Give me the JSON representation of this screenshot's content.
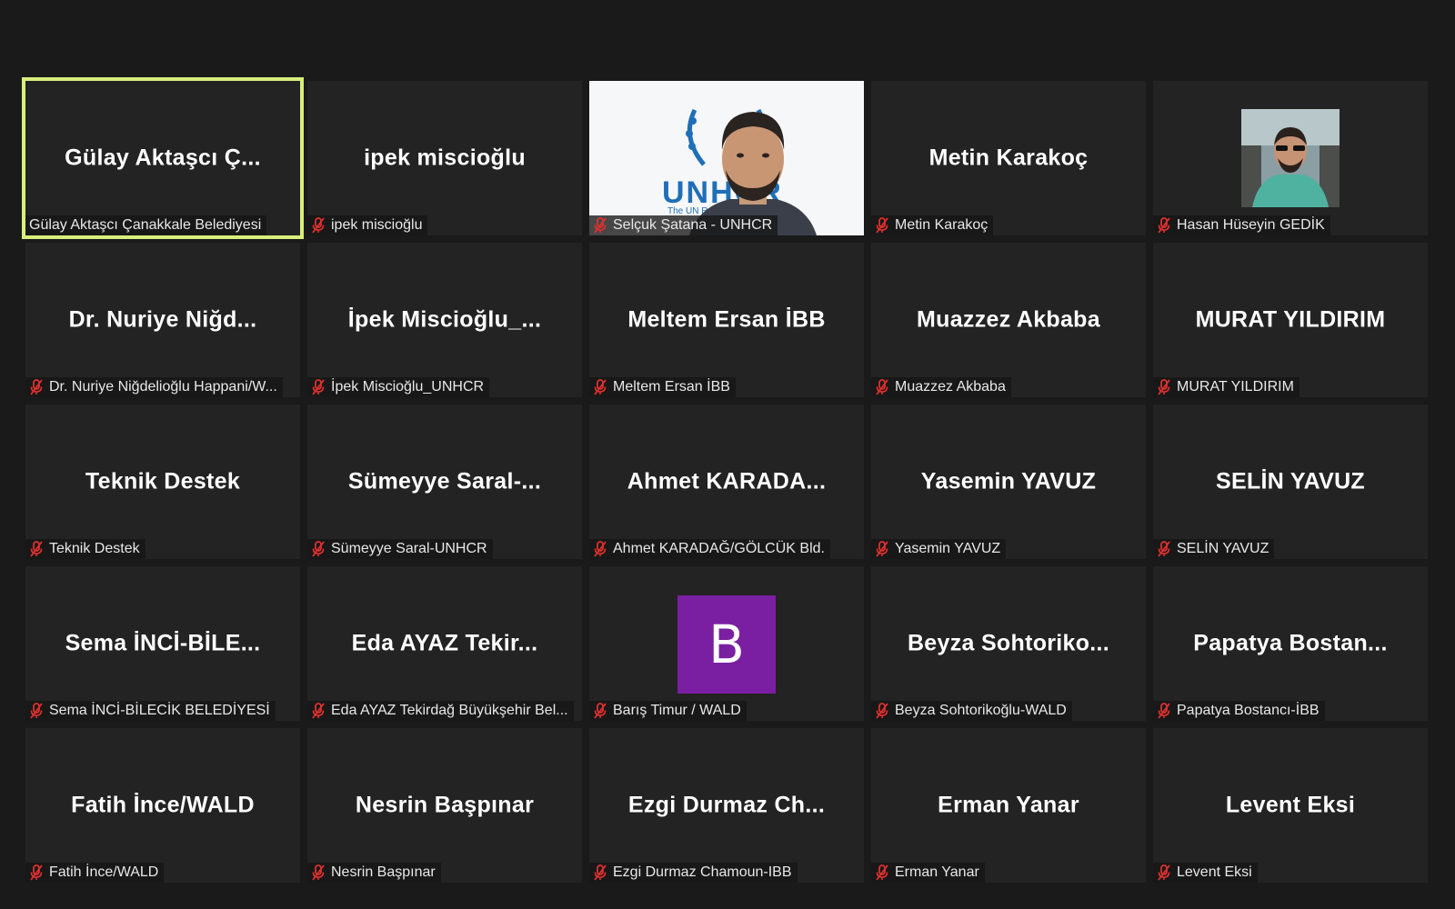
{
  "participants": [
    {
      "tile_name": "Gülay Aktaşcı Ç...",
      "label": "Gülay Aktaşcı Çanakkale Belediyesi",
      "muted": false,
      "active": true,
      "kind": "name"
    },
    {
      "tile_name": "ipek miscioğlu",
      "label": "ipek miscioğlu",
      "muted": true,
      "kind": "name"
    },
    {
      "tile_name": "",
      "label": "Selçuk Şatana - UNHCR",
      "muted": true,
      "kind": "video",
      "logo_text": "UNHCR",
      "logo_sub": "The UN Refugee Agency"
    },
    {
      "tile_name": "Metin Karakoç",
      "label": "Metin Karakoç",
      "muted": true,
      "kind": "name"
    },
    {
      "tile_name": "",
      "label": "Hasan Hüseyin GEDİK",
      "muted": true,
      "kind": "photo"
    },
    {
      "tile_name": "Dr. Nuriye Niğd...",
      "label": "Dr. Nuriye Niğdelioğlu Happani/W...",
      "muted": true,
      "kind": "name"
    },
    {
      "tile_name": "İpek Miscioğlu_...",
      "label": "İpek Miscioğlu_UNHCR",
      "muted": true,
      "kind": "name"
    },
    {
      "tile_name": "Meltem Ersan İBB",
      "label": "Meltem Ersan İBB",
      "muted": true,
      "kind": "name"
    },
    {
      "tile_name": "Muazzez Akbaba",
      "label": "Muazzez Akbaba",
      "muted": true,
      "kind": "name"
    },
    {
      "tile_name": "MURAT YILDIRIM",
      "label": "MURAT YILDIRIM",
      "muted": true,
      "kind": "name"
    },
    {
      "tile_name": "Teknik Destek",
      "label": "Teknik Destek",
      "muted": true,
      "kind": "name"
    },
    {
      "tile_name": "Sümeyye Saral-...",
      "label": "Sümeyye Saral-UNHCR",
      "muted": true,
      "kind": "name"
    },
    {
      "tile_name": "Ahmet KARADA...",
      "label": "Ahmet KARADAĞ/GÖLCÜK Bld.",
      "muted": true,
      "kind": "name"
    },
    {
      "tile_name": "Yasemin YAVUZ",
      "label": "Yasemin YAVUZ",
      "muted": true,
      "kind": "name"
    },
    {
      "tile_name": "SELİN YAVUZ",
      "label": "SELİN YAVUZ",
      "muted": true,
      "kind": "name"
    },
    {
      "tile_name": "Sema İNCİ-BİLE...",
      "label": "Sema İNCİ-BİLECİK BELEDİYESİ",
      "muted": true,
      "kind": "name"
    },
    {
      "tile_name": "Eda AYAZ Tekir...",
      "label": "Eda AYAZ Tekirdağ Büyükşehir Bel...",
      "muted": true,
      "kind": "name"
    },
    {
      "tile_name": "B",
      "label": "Barış Timur / WALD",
      "muted": true,
      "kind": "letter",
      "avatar_color": "#7b1fa2"
    },
    {
      "tile_name": "Beyza Sohtoriko...",
      "label": "Beyza Sohtorikoğlu-WALD",
      "muted": true,
      "kind": "name"
    },
    {
      "tile_name": "Papatya Bostan...",
      "label": "Papatya Bostancı-İBB",
      "muted": true,
      "kind": "name"
    },
    {
      "tile_name": "Fatih İnce/WALD",
      "label": "Fatih İnce/WALD",
      "muted": true,
      "kind": "name"
    },
    {
      "tile_name": "Nesrin Başpınar",
      "label": "Nesrin Başpınar",
      "muted": true,
      "kind": "name"
    },
    {
      "tile_name": "Ezgi Durmaz Ch...",
      "label": "Ezgi Durmaz Chamoun-IBB",
      "muted": true,
      "kind": "name"
    },
    {
      "tile_name": "Erman Yanar",
      "label": "Erman Yanar",
      "muted": true,
      "kind": "name"
    },
    {
      "tile_name": "Levent Eksi",
      "label": "Levent Eksi",
      "muted": true,
      "kind": "name"
    }
  ],
  "colors": {
    "background": "#1a1a1a",
    "tile": "#232323",
    "active_speaker_border": "#d8ef7a",
    "muted_icon": "#e0302e"
  },
  "icons": {
    "muted": "microphone-muted-icon"
  }
}
